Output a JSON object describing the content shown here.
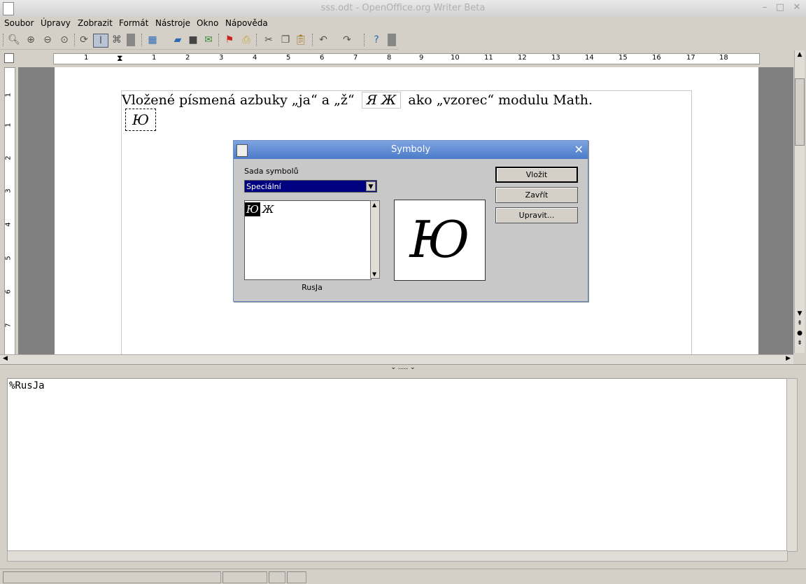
{
  "window": {
    "title": "sss.odt - OpenOffice.org Writer Beta"
  },
  "menu": [
    "Soubor",
    "Úpravy",
    "Zobrazit",
    "Formát",
    "Nástroje",
    "Okno",
    "Nápověda"
  ],
  "toolbar": {
    "icons": [
      "zoom-icon",
      "zoom-in-icon",
      "zoom-out-icon",
      "zoom-page-icon",
      "refresh-icon",
      "cursor-icon",
      "command-icon",
      "dropdown-icon",
      "formula-icon",
      "open-icon",
      "save-icon",
      "send-icon",
      "pdf-icon",
      "print-icon",
      "cut-icon",
      "copy-icon",
      "paste-icon",
      "undo-icon",
      "redo-icon",
      "help-icon"
    ]
  },
  "ruler": {
    "h_labels": [
      "1",
      "1",
      "2",
      "3",
      "4",
      "5",
      "6",
      "7",
      "8",
      "9",
      "10",
      "11",
      "12",
      "13",
      "14",
      "15",
      "16",
      "17",
      "18"
    ],
    "v_labels": [
      "1",
      "1",
      "2",
      "3",
      "4",
      "5",
      "6",
      "7"
    ]
  },
  "document": {
    "line_before": "Vložené písmená azbuky „ja“ a „ž“",
    "formula_inline": "Я Ж",
    "line_after": "ako „vzorec“ modulu Math.",
    "object_symbol": "Ю"
  },
  "dialog": {
    "title": "Symboly",
    "set_label": "Sada symbolů",
    "set_value": "Speciální",
    "symbols": [
      "Ю",
      "Ж"
    ],
    "preview": "Ю",
    "symbol_name": "RusJa",
    "buttons": {
      "insert": "Vložit",
      "close": "Zavřít",
      "edit": "Upravit..."
    }
  },
  "editor": {
    "text": "%RusJa"
  }
}
